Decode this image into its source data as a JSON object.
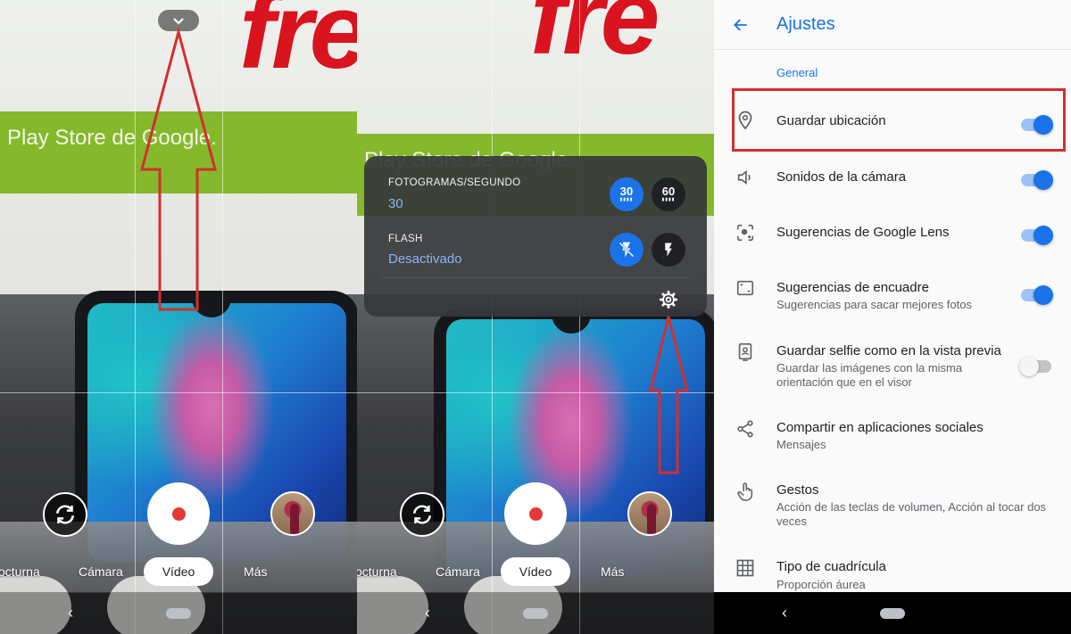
{
  "panel1": {
    "watermark": "fre",
    "banner_text": "l Play Store de Google.",
    "modes": [
      "octurna",
      "Cámara",
      "Vídeo",
      "Más"
    ],
    "active_mode": "Vídeo"
  },
  "panel2": {
    "watermark": "fre",
    "banner_text": "l Play Store de Google.",
    "quick_settings": {
      "fps_label": "FOTOGRAMAS/SEGUNDO",
      "fps_value": "30",
      "fps_options": [
        "30",
        "60"
      ],
      "flash_label": "FLASH",
      "flash_value": "Desactivado"
    },
    "modes": [
      "octurna",
      "Cámara",
      "Vídeo",
      "Más"
    ],
    "active_mode": "Vídeo"
  },
  "settings": {
    "title": "Ajustes",
    "section": "General",
    "items": [
      {
        "title": "Guardar ubicación",
        "subtitle": "",
        "enabled": true,
        "icon": "location-pin-icon"
      },
      {
        "title": "Sonidos de la cámara",
        "subtitle": "",
        "enabled": true,
        "icon": "speaker-icon"
      },
      {
        "title": "Sugerencias de Google Lens",
        "subtitle": "",
        "enabled": true,
        "icon": "lens-icon"
      },
      {
        "title": "Sugerencias de encuadre",
        "subtitle": "Sugerencias para sacar mejores fotos",
        "enabled": true,
        "icon": "frame-icon"
      },
      {
        "title": "Guardar selfie como en la vista previa",
        "subtitle": "Guardar las imágenes con la misma orientación que en el visor",
        "enabled": false,
        "icon": "selfie-icon"
      },
      {
        "title": "Compartir en aplicaciones sociales",
        "subtitle": "Mensajes",
        "icon": "share-icon"
      },
      {
        "title": "Gestos",
        "subtitle": "Acción de las teclas de volumen, Acción al tocar dos veces",
        "icon": "gesture-icon"
      },
      {
        "title": "Tipo de cuadrícula",
        "subtitle": "Proporción áurea",
        "icon": "grid-icon"
      }
    ]
  },
  "colors": {
    "accent": "#1a73e8",
    "annotation": "#d32f2f",
    "record": "#e53935"
  }
}
